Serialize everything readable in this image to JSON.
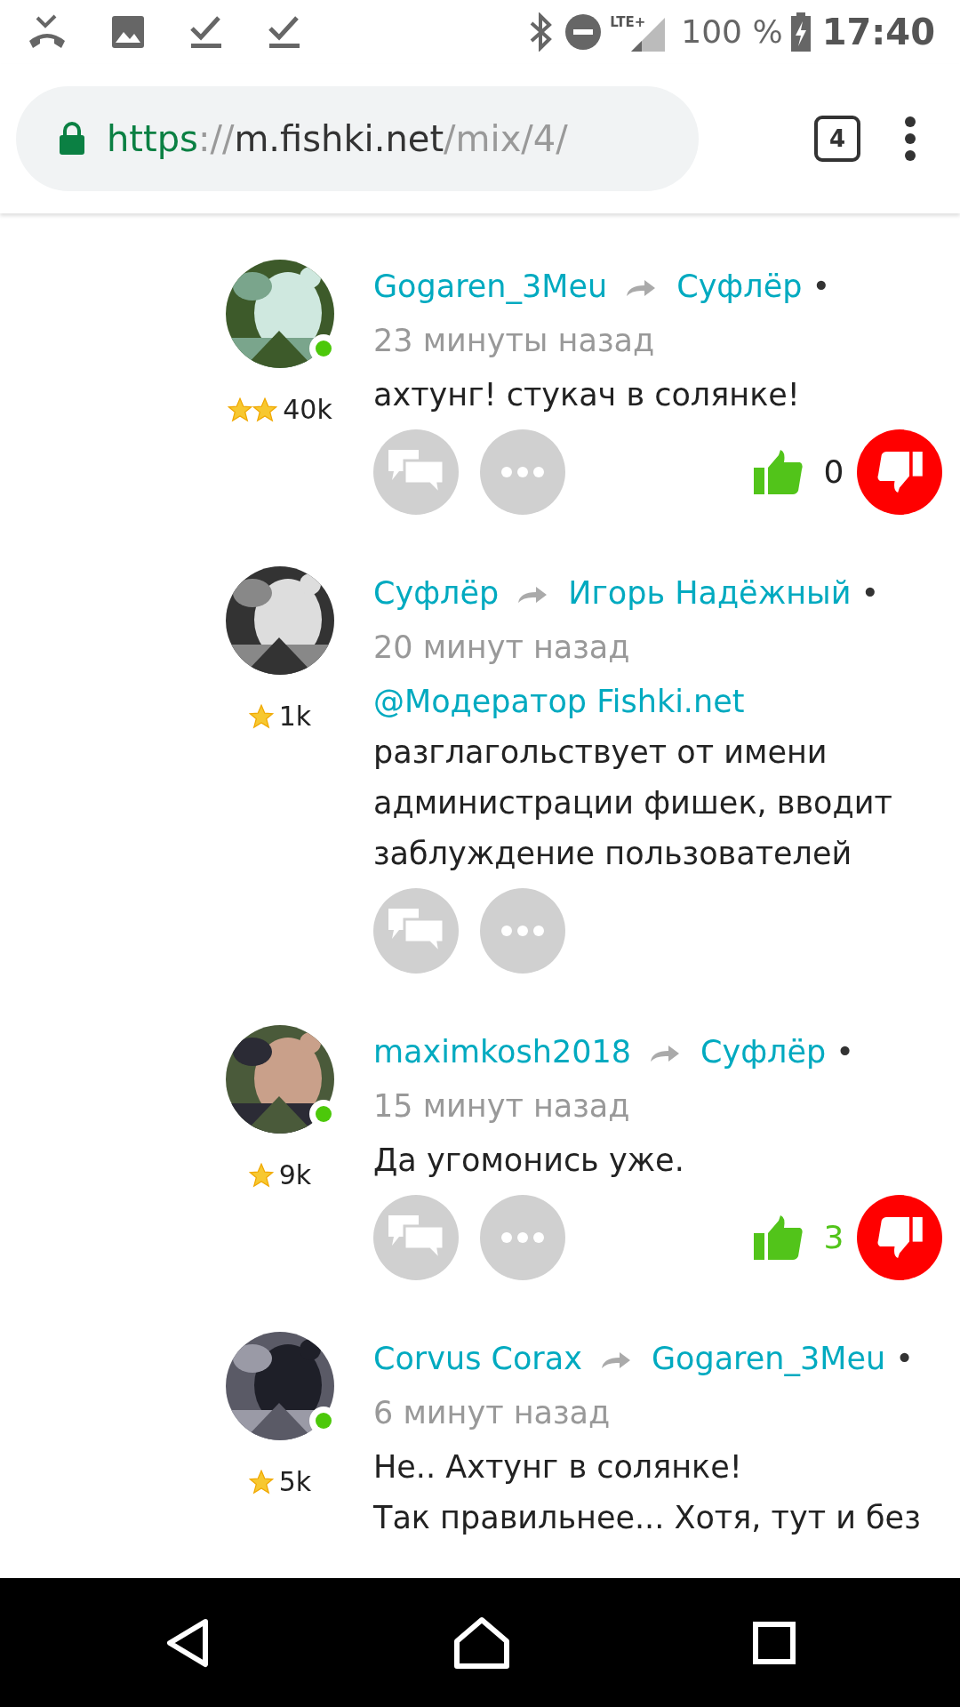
{
  "status_bar": {
    "network": "LTE+",
    "battery": "100 %",
    "time": "17:40"
  },
  "browser": {
    "url_parts": [
      {
        "kind": "scheme",
        "text": "https"
      },
      {
        "kind": "separator",
        "text": "://"
      },
      {
        "kind": "host",
        "text": "m.fishki.net"
      },
      {
        "kind": "path",
        "text": "/mix/4/"
      }
    ],
    "tab_count": "4"
  },
  "comments": [
    {
      "author": "Gogaren_3Meu",
      "reply_to": "Суфлёр",
      "bullet": "•",
      "time": "23 минуты назад",
      "online": true,
      "rank_badges": [
        {
          "kind": "star"
        },
        {
          "kind": "star"
        }
      ],
      "rating": "40k",
      "lines": [
        "ахтунг! стукач в солянке!"
      ],
      "has_actions": true,
      "votes": {
        "count": "0",
        "positive": false
      }
    },
    {
      "author": "Суфлёр",
      "reply_to": "Игорь Надёжный",
      "bullet": "•",
      "time": "20 минут назад",
      "online": false,
      "rank_badges": [
        {
          "kind": "star"
        }
      ],
      "rating": "1k",
      "mention": "@Модератор Fishki.net",
      "lines": [
        "разглагольствует от имени администрации фишек, вводит заблуждение пользователей"
      ],
      "has_actions": true
    },
    {
      "author": "maximkosh2018",
      "reply_to": "Суфлёр",
      "bullet": "•",
      "time": "15 минут назад",
      "online": true,
      "rank_badges": [
        {
          "kind": "star"
        }
      ],
      "rating": "9k",
      "lines": [
        "Да угомонись уже."
      ],
      "has_actions": true,
      "votes": {
        "count": "3",
        "positive": true
      }
    },
    {
      "author": "Corvus Corax",
      "reply_to": "Gogaren_3Meu",
      "bullet": "•",
      "time": "6 минут назад",
      "online": true,
      "rank_badges": [
        {
          "kind": "star"
        }
      ],
      "rating": "5k",
      "lines": [
        "Не.. Ахтунг в солянке!",
        "Так правильнее... Хотя, тут и без"
      ]
    }
  ]
}
